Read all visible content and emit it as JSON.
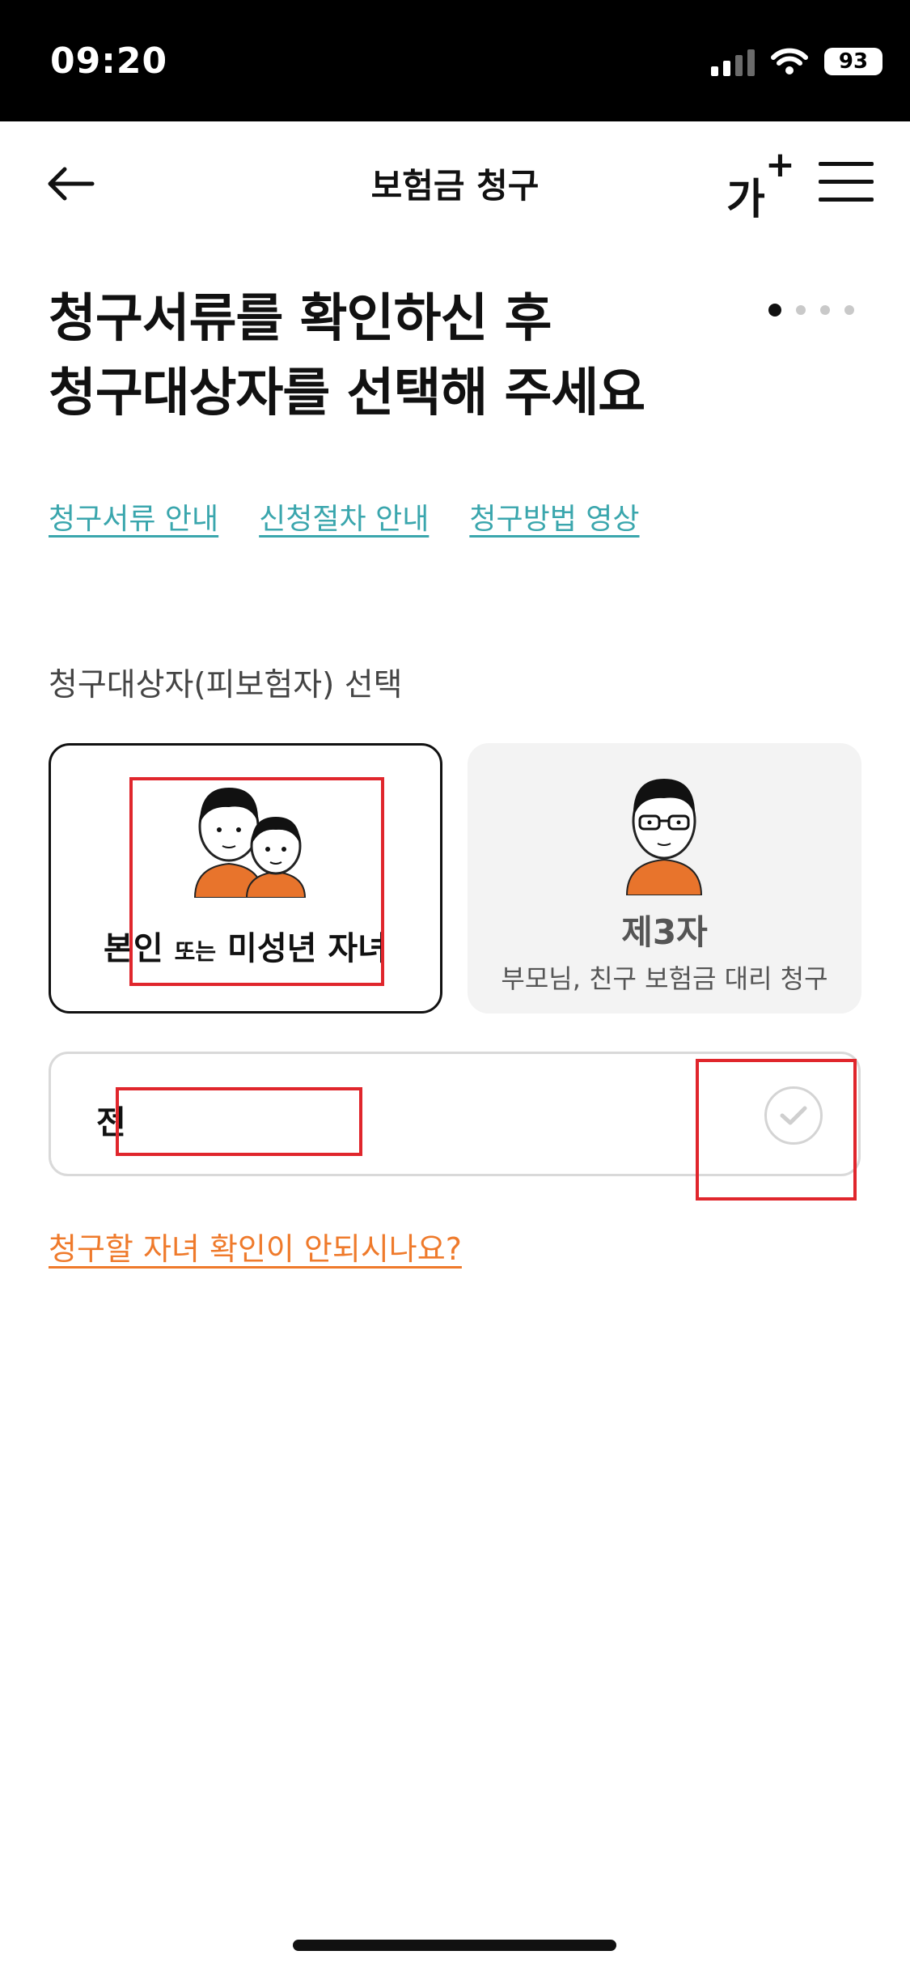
{
  "status_bar": {
    "time": "09:20",
    "battery": "93",
    "icons": [
      "cellular-signal-icon",
      "wifi-icon",
      "battery-icon"
    ]
  },
  "header": {
    "title": "보험금 청구",
    "back_icon": "arrow-left-icon",
    "font_size_label": "가",
    "font_size_plus": "+",
    "menu_icon": "hamburger-menu-icon"
  },
  "headline": {
    "line1": "청구서류를 확인하신 후",
    "line2": "청구대상자를 선택해 주세요"
  },
  "progress": {
    "current_step": 1,
    "total_steps": 4
  },
  "links": {
    "docs_guide": "청구서류 안내",
    "procedure_guide": "신청절차 안내",
    "video_guide": "청구방법 영상"
  },
  "section": {
    "label": "청구대상자(피보험자) 선택"
  },
  "cards": {
    "self": {
      "label_a": "본인",
      "label_or": "또는",
      "label_b": "미성년 자녀"
    },
    "third_party": {
      "label": "제3자",
      "sub": "부모님, 친구 보험금 대리 청구"
    }
  },
  "name_field": {
    "value": "전"
  },
  "help_link": "청구할 자녀 확인이 안되시나요?",
  "colors": {
    "link_teal": "#3aa6ad",
    "help_orange": "#ef7a2b",
    "redaction_red": "#e0262c",
    "shirt_orange": "#e8742c"
  }
}
